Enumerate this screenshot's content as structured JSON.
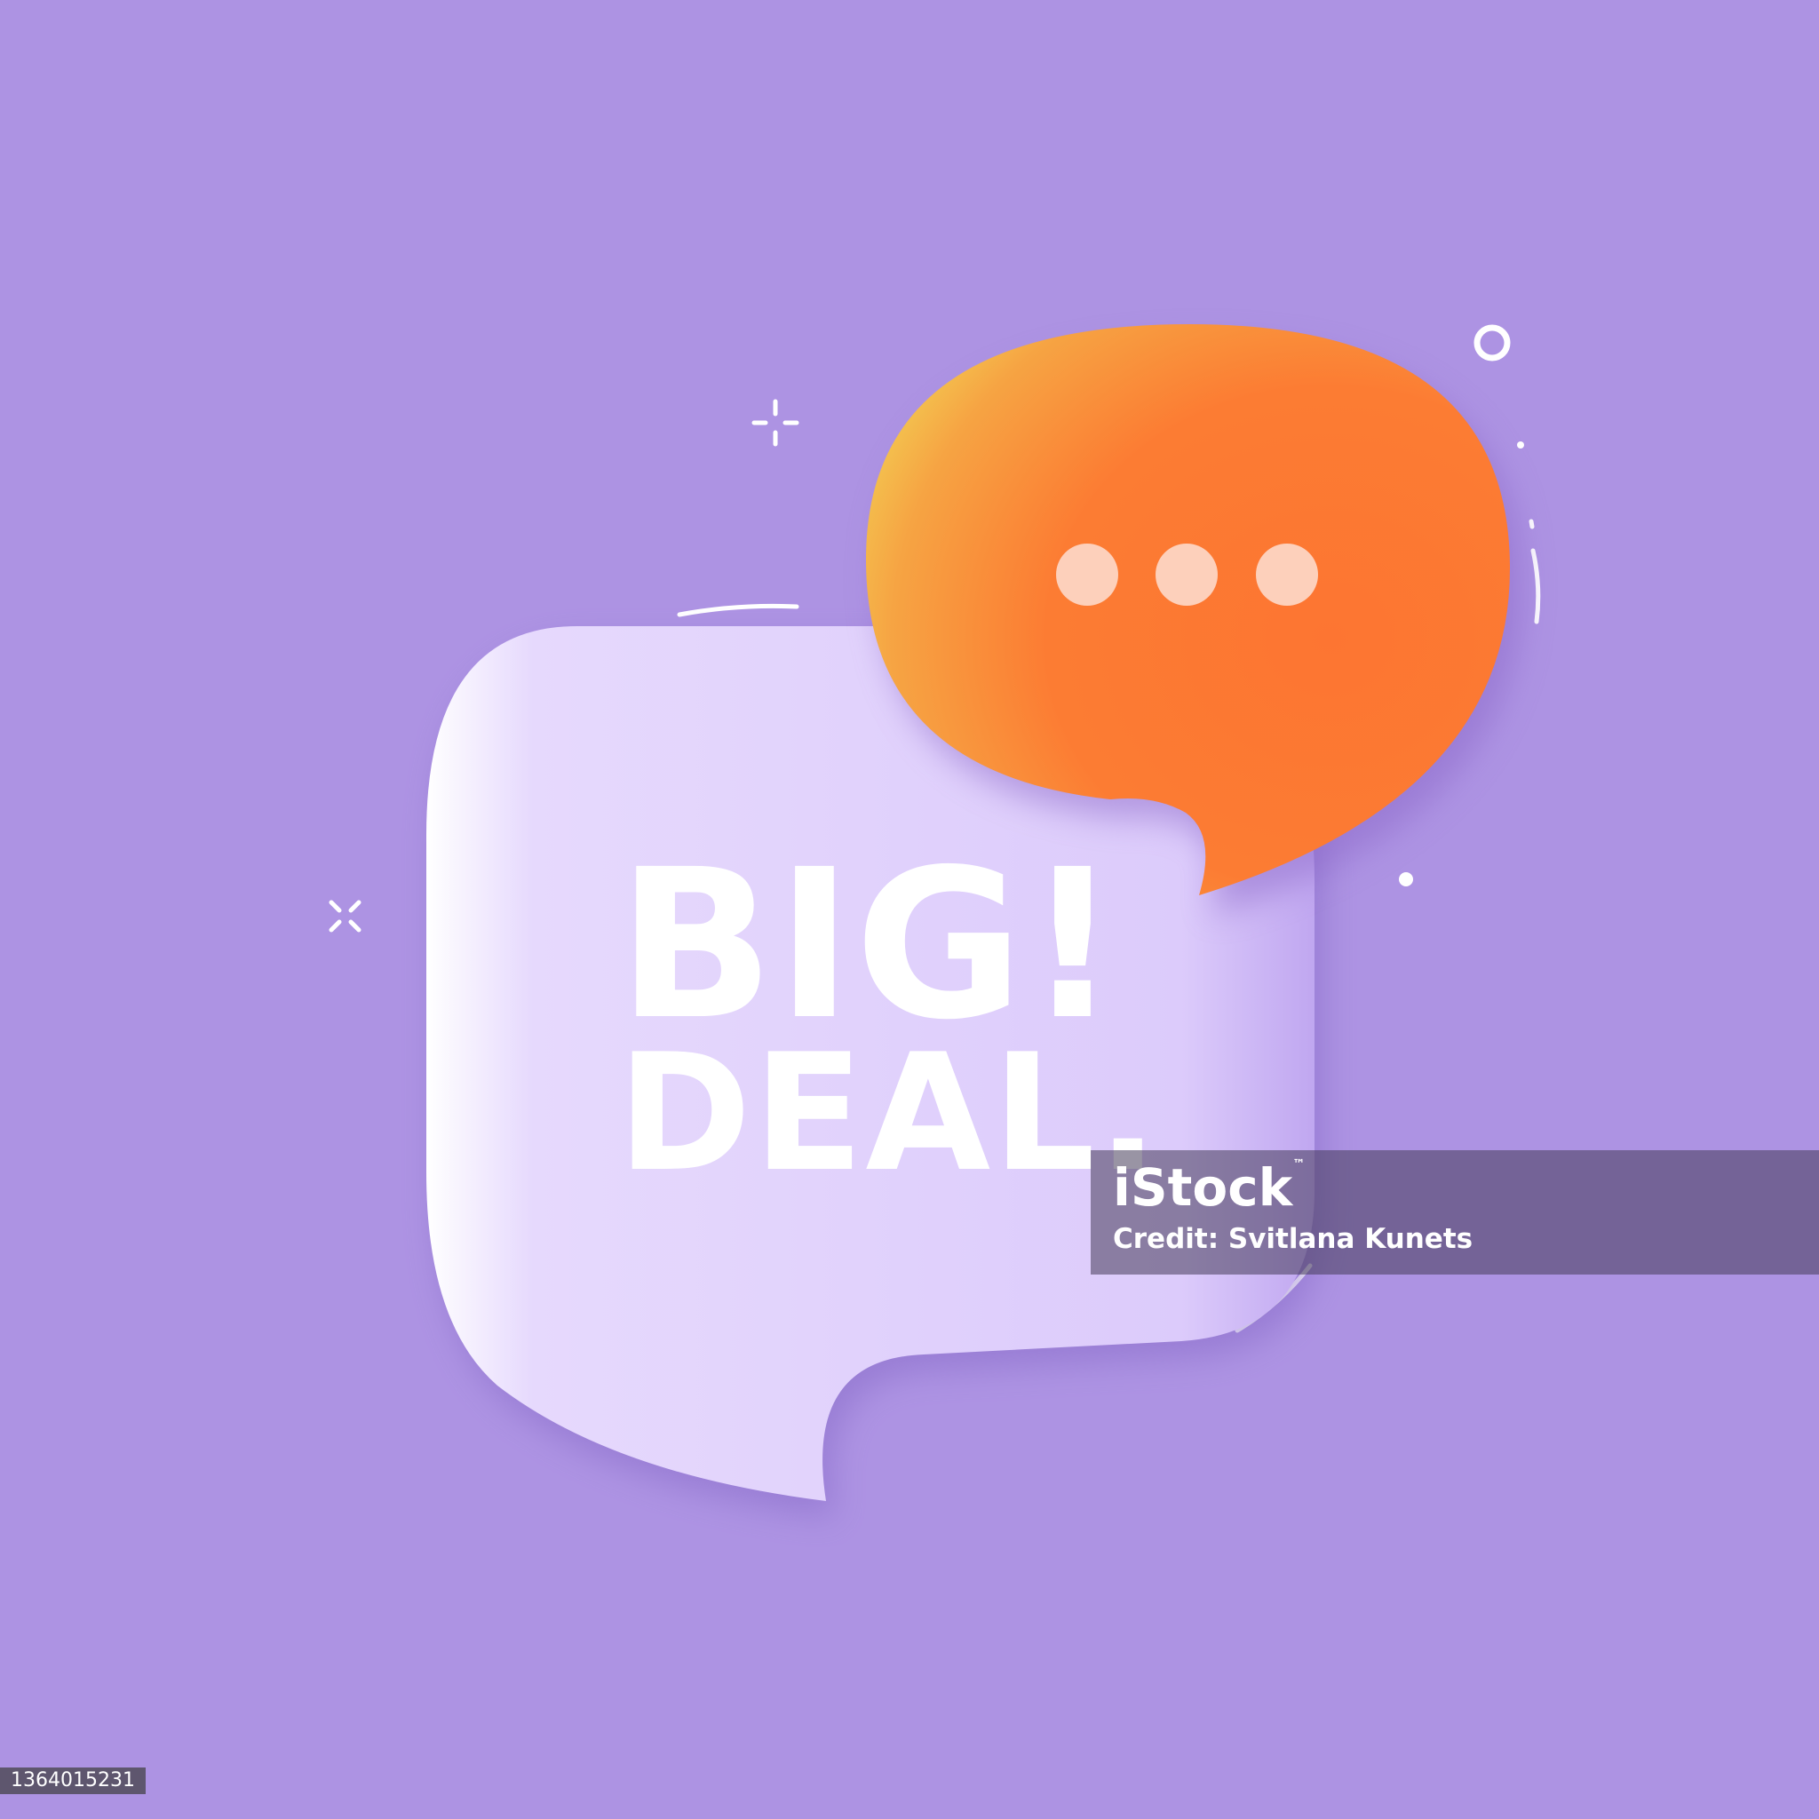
{
  "colors": {
    "background": "#ad93e3",
    "bubble_light": "#e2d4fc",
    "bubble_orange": "#fc7a2f",
    "bubble_yellow": "#f5c54c",
    "dots": "#fdd0bb",
    "text": "#ffffff"
  },
  "headline": {
    "line1": "BIG!",
    "line2": "DEAL."
  },
  "orange_bubble": {
    "icon": "ellipsis-dots-icon"
  },
  "watermark": {
    "brand": "iStock",
    "trademark": "™",
    "credit": "Credit: Svitlana Kunets"
  },
  "stock_id": "1364015231"
}
